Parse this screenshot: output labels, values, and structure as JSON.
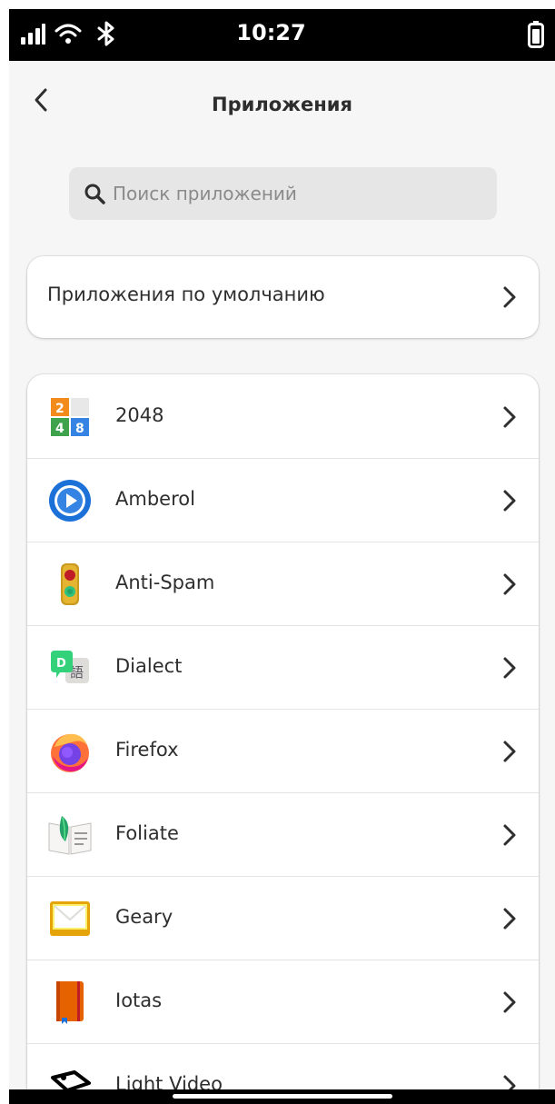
{
  "status_bar": {
    "time": "10:27",
    "icons": [
      "signal-icon",
      "wifi-icon",
      "bluetooth-icon",
      "battery-icon"
    ]
  },
  "header": {
    "title": "Приложения",
    "back_icon": "chevron-left-icon"
  },
  "search": {
    "placeholder": "Поиск приложений",
    "value": ""
  },
  "default_apps": {
    "label": "Приложения по умолчанию"
  },
  "apps": [
    {
      "name": "2048",
      "icon": "2048-icon"
    },
    {
      "name": "Amberol",
      "icon": "amberol-icon"
    },
    {
      "name": "Anti-Spam",
      "icon": "anti-spam-icon"
    },
    {
      "name": "Dialect",
      "icon": "dialect-icon"
    },
    {
      "name": "Firefox",
      "icon": "firefox-icon"
    },
    {
      "name": "Foliate",
      "icon": "foliate-icon"
    },
    {
      "name": "Geary",
      "icon": "geary-icon"
    },
    {
      "name": "Iotas",
      "icon": "iotas-icon"
    },
    {
      "name": "Light Video",
      "icon": "light-video-icon"
    }
  ],
  "colors": {
    "background": "#f6f6f6",
    "card": "#ffffff",
    "text": "#2e2e2e",
    "search_bg": "#e6e6e6",
    "placeholder": "#8a8a8a"
  }
}
